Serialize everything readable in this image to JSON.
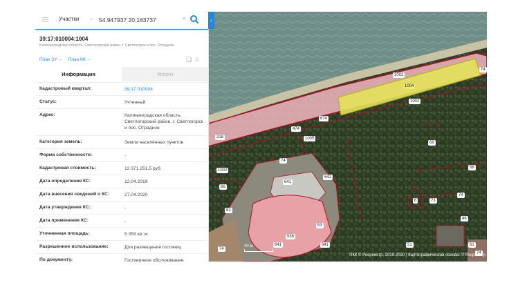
{
  "search": {
    "layer": "Участки",
    "query": "54.947937 20.163737"
  },
  "parcel": {
    "number": "39:17:010004:1004",
    "address_short": "Калининградская область, Светлогорский район, г. Светлогорск и пос. Отрадное"
  },
  "links": {
    "plan_zu": "План ЗУ →",
    "plan_kk": "План КК →"
  },
  "tabs": {
    "info": "Информация",
    "services": "Услуги"
  },
  "attributes": [
    {
      "key": "Кадастровый квартал:",
      "value": "39:17:010004",
      "link": true
    },
    {
      "key": "Статус:",
      "value": "Учтенный"
    },
    {
      "key": "Адрес:",
      "value": "Калининградская область, Светлогорский район, г. Светлогорск и пос. Отрадное"
    },
    {
      "key": "Категория земель:",
      "value": "Земли населённых пунктов"
    },
    {
      "key": "Форма собственности:",
      "value": "-"
    },
    {
      "key": "Кадастровая стоимость:",
      "value": "12 371 251,5 руб."
    },
    {
      "key": "Дата определения КС:",
      "value": "12.04.2019"
    },
    {
      "key": "Дата внесения сведений о КС:",
      "value": "27.04.2020"
    },
    {
      "key": "Дата утверждения КС:",
      "value": "-"
    },
    {
      "key": "Дата применения КС:",
      "value": "-"
    },
    {
      "key": "Уточненная площадь:",
      "value": "5 359 кв. м"
    },
    {
      "key": "Разрешенное использование:",
      "value": "Для размещения гостиниц"
    },
    {
      "key": "По документу:",
      "value": "Гостиничное обслуживание"
    }
  ],
  "map": {
    "scale": "40 м",
    "attribution": "ПКК © Росреестр, 2010-2020 | Картографическая основа: © Росреестр",
    "labels": [
      "1002",
      "1004",
      "1002",
      "74",
      "674",
      "474",
      "1005",
      "318",
      "010004",
      "68",
      "74",
      "1002",
      "66",
      "641",
      "641",
      "58",
      "82",
      "6",
      "73",
      "74",
      "53",
      "536",
      "641",
      "641",
      "46",
      "51",
      "74",
      "61",
      "74"
    ]
  },
  "colors": {
    "accent": "#1e88e5",
    "parcel_fill": "#f2b7c1",
    "selected_fill": "#e3e25a",
    "boundary": "#b10f21"
  }
}
